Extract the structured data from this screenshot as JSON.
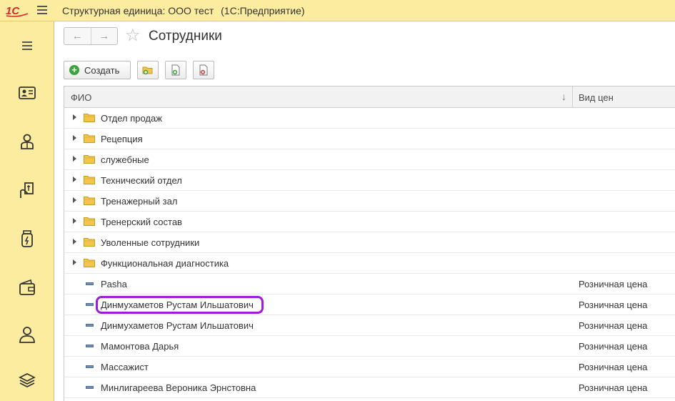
{
  "titlebar": {
    "logo": "1С",
    "title": "Структурная единица: ООО тест",
    "app": "(1С:Предприятие)"
  },
  "nav": {
    "back": "←",
    "forward": "→"
  },
  "page": {
    "star": "☆",
    "title": "Сотрудники"
  },
  "toolbar": {
    "create_label": "Создать"
  },
  "table": {
    "headers": {
      "fio": "ФИО",
      "sort": "↓",
      "price_type": "Вид цен"
    },
    "rows": [
      {
        "name": "Отдел продаж",
        "type": "folder",
        "price": ""
      },
      {
        "name": "Рецепция",
        "type": "folder",
        "price": ""
      },
      {
        "name": "служебные",
        "type": "folder",
        "price": ""
      },
      {
        "name": "Технический отдел",
        "type": "folder",
        "price": ""
      },
      {
        "name": "Тренажерный зал",
        "type": "folder",
        "price": ""
      },
      {
        "name": "Тренерский состав",
        "type": "folder",
        "price": ""
      },
      {
        "name": "Уволенные сотрудники",
        "type": "folder",
        "price": ""
      },
      {
        "name": "Функциональная диагностика",
        "type": "folder",
        "price": ""
      },
      {
        "name": "Pasha",
        "type": "item",
        "price": "Розничная цена"
      },
      {
        "name": "Динмухаметов Рустам Ильшатович",
        "type": "item",
        "price": "Розничная цена",
        "highlighted": true
      },
      {
        "name": "Динмухаметов Рустам Ильшатович",
        "type": "item",
        "price": "Розничная цена"
      },
      {
        "name": "Мамонтова Дарья",
        "type": "item",
        "price": "Розничная цена"
      },
      {
        "name": "Массажист",
        "type": "item",
        "price": "Розничная цена"
      },
      {
        "name": "Минлигареева Вероника Эрнстовна",
        "type": "item",
        "price": "Розничная цена"
      }
    ]
  },
  "colors": {
    "accent": "#fbeca0",
    "highlight": "#9b1ed4",
    "folder": "#f3c64b"
  },
  "sidebar_icons": [
    "id-card-icon",
    "employee-icon",
    "hand-money-icon",
    "jar-icon",
    "wallet-icon",
    "person-icon",
    "stack-icon"
  ]
}
